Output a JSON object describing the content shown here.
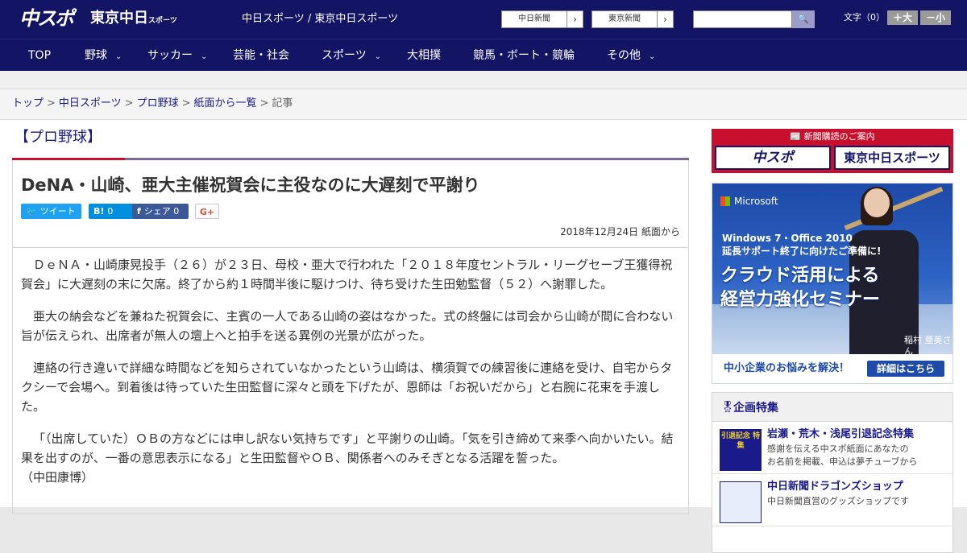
{
  "header": {
    "logo_chuspo": "中スポ",
    "logo_tokyo": "東京中日",
    "logo_tokyo_suffix": "スポーツ",
    "tagline": "中日スポーツ / 東京中日スポーツ",
    "link_chunichi": "中日新聞",
    "link_tokyo": "東京新聞",
    "link_arrow": "›",
    "search_icon": "🔍",
    "fontsize_label": "文字（0）",
    "font_larger": "＋大",
    "font_smaller": "－小"
  },
  "nav": {
    "items": [
      {
        "label": "TOP"
      },
      {
        "label": "野球",
        "dropdown": "⌄"
      },
      {
        "label": "サッカー",
        "dropdown": "⌄"
      },
      {
        "label": "芸能・社会"
      },
      {
        "label": "スポーツ",
        "dropdown": "⌄"
      },
      {
        "label": "大相撲"
      },
      {
        "label": "競馬・ボート・競輪"
      },
      {
        "label": "その他",
        "dropdown": "⌄"
      }
    ]
  },
  "breadcrumb": {
    "items": [
      "トップ",
      "中日スポーツ",
      "プロ野球",
      "紙面から一覧"
    ],
    "separator": ">",
    "current": "記事"
  },
  "article": {
    "section": "【プロ野球】",
    "title": "DeNA・山崎、亜大主催祝賀会に主役なのに大遅刻で平謝り",
    "share": {
      "tweet": "ツイート",
      "hatena_icon": "B!",
      "hatena_count": "0",
      "facebook_icon": "f",
      "facebook": "シェア",
      "facebook_count": "0",
      "gplus": "G+"
    },
    "date": "2018年12月24日 紙面から",
    "paragraphs": [
      "ＤｅＮＡ・山崎康晃投手（２６）が２３日、母校・亜大で行われた「２０１８年度セントラル・リーグセーブ王獲得祝賀会」に大遅刻の末に欠席。終了から約１時間半後に駆けつけ、待ち受けた生田勉監督（５２）へ謝罪した。",
      "亜大の納会などを兼ねた祝賀会に、主賓の一人である山崎の姿はなかった。式の終盤には司会から山崎が間に合わない旨が伝えられ、出席者が無人の壇上へと拍手を送る異例の光景が広がった。",
      "連絡の行き違いで詳細な時間などを知らされていなかったという山崎は、横須賀での練習後に連絡を受け、自宅からタクシーで会場へ。到着後は待っていた生田監督に深々と頭を下げたが、恩師は「お祝いだから」と右腕に花束を手渡した。",
      "「（出席していた）ＯＢの方などには申し訳ない気持ちです」と平謝りの山崎。「気を引き締めて来季へ向かいたい。結果を出すのが、一番の意思表示になる」と生田監督やＯＢ、関係者へのみそぎとなる活躍を誓った。"
    ],
    "byline": "（中田康博）"
  },
  "sidebar": {
    "subscribe_label": "📰 新聞購読のご案内",
    "subscribe_chuspo": "中スポ",
    "subscribe_tokyo": "東京中日スポーツ",
    "ad": {
      "brand": "Microsoft",
      "line1": "Windows 7・Office 2010",
      "line2": "延長サポート終了に向けたご準備に!",
      "headline1": "クラウド活用による",
      "headline2": "経営力強化セミナー",
      "person": "稲村 亜美さん",
      "cta": "中小企業のお悩みを解決！",
      "cta_button": "詳細はこちら"
    },
    "features": {
      "title": "企画特集",
      "items": [
        {
          "title": "岩瀬・荒木・浅尾引退記念特集",
          "desc1": "感謝を伝える中スポ紙面にあなたの",
          "desc2": "お名前を掲載、申込は夢チューブから",
          "thumb": "引退記念 特集"
        },
        {
          "title": "中日新聞ドラゴンズショップ",
          "desc1": "中日新聞直営のグッズショップです",
          "desc2": ""
        }
      ]
    }
  }
}
